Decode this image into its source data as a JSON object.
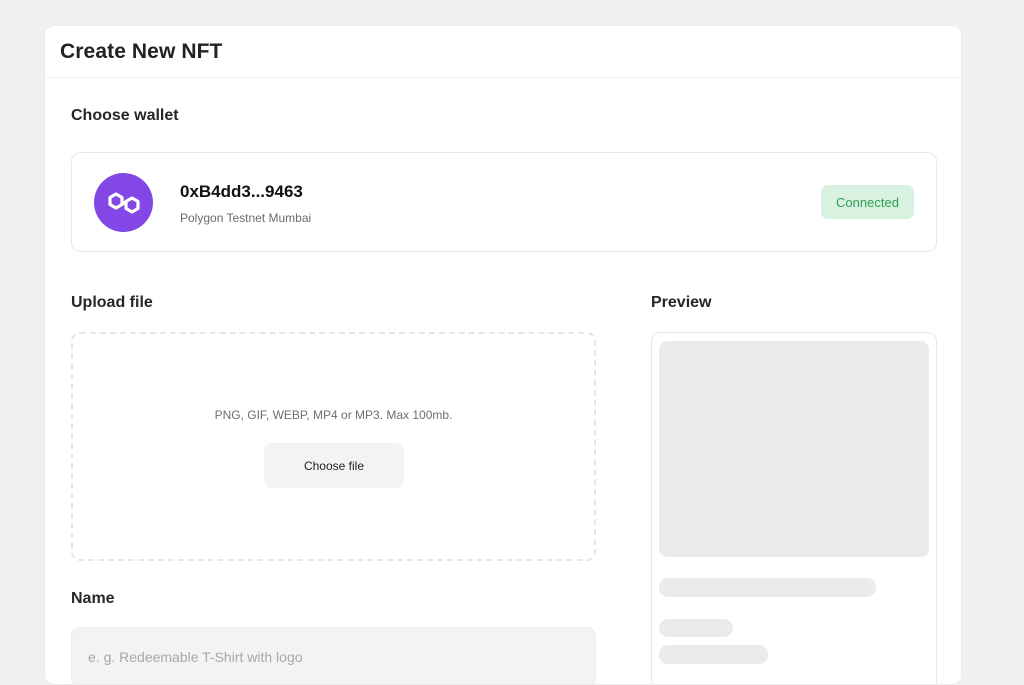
{
  "header": {
    "title": "Create New NFT"
  },
  "wallet": {
    "section_label": "Choose wallet",
    "address": "0xB4dd3...9463",
    "network": "Polygon Testnet Mumbai",
    "status": "Connected",
    "logo_icon": "polygon-logo-icon",
    "logo_color": "#8247e5",
    "status_color": "#2f9e53",
    "status_bg": "#d8f1e1"
  },
  "upload": {
    "section_label": "Upload file",
    "hint": "PNG, GIF, WEBP, MP4 or MP3. Max 100mb.",
    "button_label": "Choose file"
  },
  "preview": {
    "section_label": "Preview"
  },
  "name_field": {
    "label": "Name",
    "value": "",
    "placeholder": "e. g. Redeemable T-Shirt with logo"
  }
}
